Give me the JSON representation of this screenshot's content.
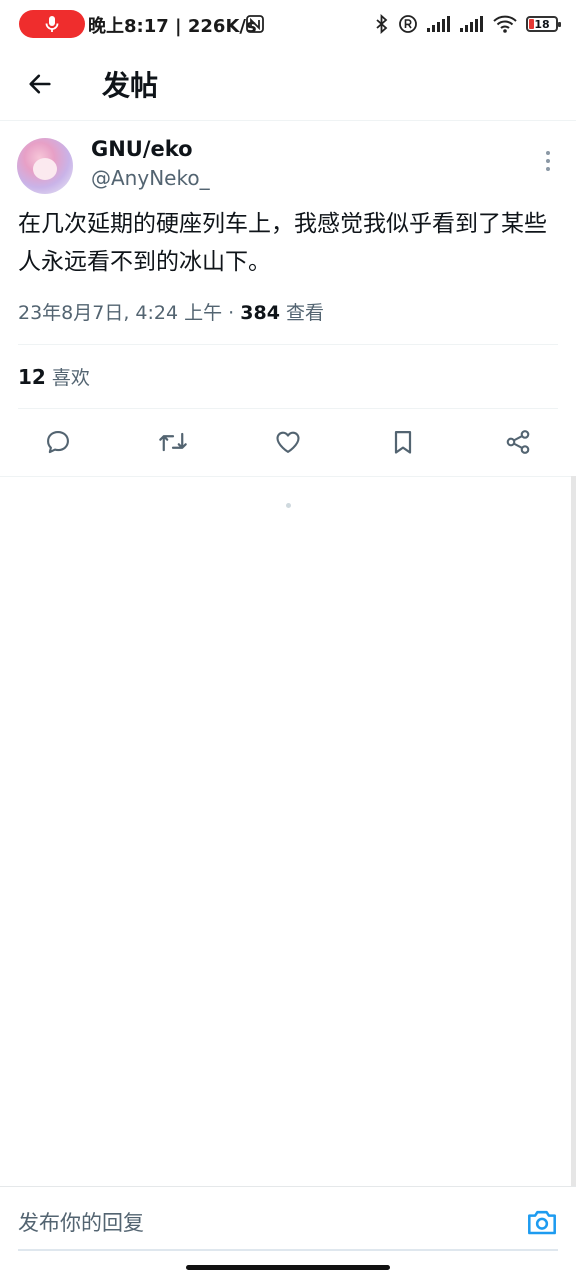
{
  "status_bar": {
    "time_speed": "晚上8:17 | 226K/s",
    "battery": "18",
    "icons": [
      "mic-icon",
      "nfc-icon",
      "bluetooth-icon",
      "registered-icon",
      "signal-icon",
      "signal-icon",
      "wifi-icon",
      "battery-icon"
    ]
  },
  "header": {
    "title": "发帖",
    "back_icon": "arrow-left-icon"
  },
  "post": {
    "author_name": "GNU/eko",
    "author_handle": "@AnyNeko_",
    "text": "在几次延期的硬座列车上，我感觉我似乎看到了某些人永远看不到的冰山下。",
    "date": "23年8月7日, 4:24 上午 · ",
    "views_count": "384",
    "views_label": " 查看",
    "likes_count": "12",
    "likes_label": " 喜欢",
    "actions": [
      "reply-icon",
      "retweet-icon",
      "like-icon",
      "bookmark-icon",
      "share-icon"
    ]
  },
  "reply": {
    "placeholder": "发布你的回复"
  },
  "colors": {
    "text": "#0f1419",
    "secondary": "#536471",
    "accent": "#1d9bf0",
    "record": "#ef2d2d"
  }
}
